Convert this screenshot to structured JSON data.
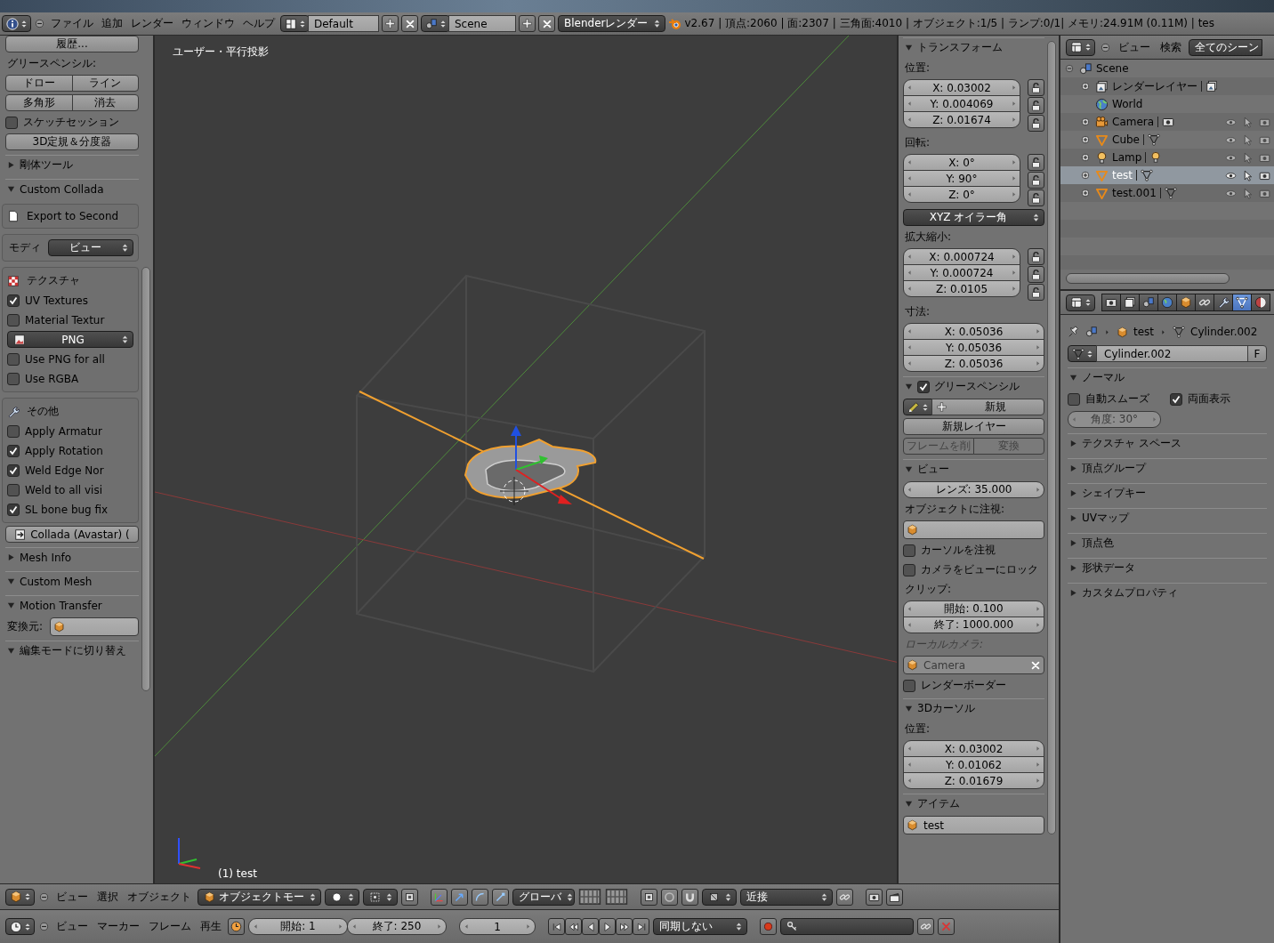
{
  "top_header": {
    "menus": [
      "ファイル",
      "追加",
      "レンダー",
      "ウィンドウ",
      "ヘルプ"
    ],
    "layout": "Default",
    "scene": "Scene",
    "engine": "Blenderレンダー",
    "stats": "v2.67 | 頂点:2060 | 面:2307 | 三角面:4010 | オブジェクト:1/5 | ランプ:0/1| メモリ:24.91M (0.11M) | tes"
  },
  "tool_shelf": {
    "rows": [
      {
        "kind": "button",
        "label": "履歴..."
      },
      {
        "kind": "label",
        "label": "グリースペンシル:"
      },
      {
        "kind": "buttons",
        "labels": [
          "ドロー",
          "ライン"
        ]
      },
      {
        "kind": "buttons",
        "labels": [
          "多角形",
          "消去"
        ]
      },
      {
        "kind": "checkbox",
        "label": "スケッチセッション",
        "checked": false
      },
      {
        "kind": "button",
        "label": "3D定規＆分度器"
      },
      {
        "kind": "header",
        "label": "剛体ツール",
        "expanded": false
      },
      {
        "kind": "header",
        "label": "Custom Collada",
        "expanded": true
      },
      {
        "kind": "box",
        "rows": [
          {
            "kind": "export_toggle",
            "label": "Export to Second"
          }
        ]
      },
      {
        "kind": "box",
        "rows": [
          {
            "kind": "dropdown",
            "label": "モディ",
            "value": "ビュー"
          }
        ]
      },
      {
        "kind": "box",
        "rows": [
          {
            "kind": "texture_heading",
            "label": "テクスチャ"
          },
          {
            "kind": "checkbox",
            "label": "UV Textures",
            "checked": true
          },
          {
            "kind": "checkbox",
            "label": "Material Textur",
            "checked": false
          },
          {
            "kind": "format_dropdown",
            "value": "PNG"
          },
          {
            "kind": "checkbox",
            "label": "Use PNG for all",
            "checked": false
          },
          {
            "kind": "checkbox",
            "label": "Use RGBA",
            "checked": false
          }
        ]
      },
      {
        "kind": "box",
        "rows": [
          {
            "kind": "settings_heading",
            "label": "その他"
          },
          {
            "kind": "checkbox",
            "label": "Apply Armatur",
            "checked": false
          },
          {
            "kind": "checkbox",
            "label": "Apply Rotation",
            "checked": true
          },
          {
            "kind": "checkbox",
            "label": "Weld Edge Nor",
            "checked": true
          },
          {
            "kind": "checkbox",
            "label": "Weld to all visi",
            "checked": false
          },
          {
            "kind": "checkbox",
            "label": "SL bone bug fix",
            "checked": true
          }
        ]
      },
      {
        "kind": "export_button",
        "label": "Collada (Avastar) ("
      },
      {
        "kind": "header",
        "label": "Mesh Info",
        "expanded": false
      },
      {
        "kind": "header",
        "label": "Custom Mesh",
        "expanded": true
      },
      {
        "kind": "header",
        "label": "Motion Transfer",
        "expanded": true
      },
      {
        "kind": "field",
        "label": "変換元:"
      },
      {
        "kind": "header",
        "label": "編集モードに切り替え",
        "expanded": true
      }
    ]
  },
  "viewport": {
    "view_label": "ユーザー・平行投影",
    "object_label": "(1) test"
  },
  "n_panel": {
    "rows": [
      {
        "kind": "header",
        "label": "トランスフォーム",
        "expanded": true
      },
      {
        "kind": "label",
        "label": "位置:"
      },
      {
        "kind": "vector",
        "values": [
          "X: 0.03002",
          "Y: 0.004069",
          "Z: 0.01674"
        ],
        "locks": true
      },
      {
        "kind": "label",
        "label": "回転:"
      },
      {
        "kind": "vector",
        "values": [
          "X: 0°",
          "Y: 90°",
          "Z: 0°"
        ],
        "locks": true
      },
      {
        "kind": "dropdown",
        "value": "XYZ オイラー角"
      },
      {
        "kind": "label",
        "label": "拡大縮小:"
      },
      {
        "kind": "vector",
        "values": [
          "X: 0.000724",
          "Y: 0.000724",
          "Z: 0.0105"
        ],
        "locks": true
      },
      {
        "kind": "label",
        "label": "寸法:"
      },
      {
        "kind": "vector",
        "values": [
          "X: 0.05036",
          "Y: 0.05036",
          "Z: 0.05036"
        ],
        "locks": false
      },
      {
        "kind": "header",
        "label": "グリースペンシル",
        "expanded": true,
        "checked": true
      },
      {
        "kind": "new_button",
        "label": "新規"
      },
      {
        "kind": "button",
        "label": "新規レイヤー"
      },
      {
        "kind": "buttons",
        "labels": [
          "フレームを削",
          "変換"
        ],
        "disabled": true
      },
      {
        "kind": "header",
        "label": "ビュー",
        "expanded": true
      },
      {
        "kind": "number",
        "value": "レンズ: 35.000"
      },
      {
        "kind": "label",
        "label": "オブジェクトに注視:"
      },
      {
        "kind": "object_field"
      },
      {
        "kind": "checkbox",
        "label": "カーソルを注視",
        "checked": false
      },
      {
        "kind": "checkbox",
        "label": "カメラをビューにロック",
        "checked": false
      },
      {
        "kind": "label",
        "label": "クリップ:"
      },
      {
        "kind": "vector",
        "values": [
          "開始: 0.100",
          "終了: 1000.000"
        ],
        "locks": false
      },
      {
        "kind": "label",
        "label": "ローカルカメラ:",
        "disabled": true
      },
      {
        "kind": "object_field",
        "value": "Camera",
        "disabled": true,
        "clearable": true
      },
      {
        "kind": "checkbox",
        "label": "レンダーボーダー",
        "checked": false
      },
      {
        "kind": "header",
        "label": "3Dカーソル",
        "expanded": true
      },
      {
        "kind": "label",
        "label": "位置:"
      },
      {
        "kind": "vector",
        "values": [
          "X: 0.03002",
          "Y: 0.01062",
          "Z: 0.01679"
        ],
        "locks": false
      },
      {
        "kind": "header",
        "label": "アイテム",
        "expanded": true
      },
      {
        "kind": "object_field",
        "value": "test"
      }
    ]
  },
  "outliner": {
    "menus": [
      "ビュー",
      "検索"
    ],
    "scope": "全てのシーン",
    "tree": [
      {
        "label": "Scene",
        "kind": "scene",
        "expanded": true,
        "selected": false,
        "children": [
          {
            "label": "レンダーレイヤー",
            "kind": "renderlayer",
            "expanded": false,
            "selected": false
          },
          {
            "label": "World",
            "kind": "world",
            "selected": false
          },
          {
            "label": "Camera",
            "kind": "camera",
            "expanded": false,
            "selected": false
          },
          {
            "label": "Cube",
            "kind": "mesh",
            "expanded": false,
            "selected": false
          },
          {
            "label": "Lamp",
            "kind": "lamp",
            "expanded": false,
            "selected": false
          },
          {
            "label": "test",
            "kind": "mesh",
            "expanded": false,
            "selected": true
          },
          {
            "label": "test.001",
            "kind": "mesh",
            "expanded": false,
            "selected": false
          }
        ]
      }
    ]
  },
  "properties": {
    "tabs": [
      {
        "kind": "render",
        "selected": false
      },
      {
        "kind": "renderlayers",
        "selected": false
      },
      {
        "kind": "scene",
        "selected": false
      },
      {
        "kind": "world",
        "selected": false
      },
      {
        "kind": "object",
        "selected": false
      },
      {
        "kind": "constraints",
        "selected": false
      },
      {
        "kind": "modifiers",
        "selected": false
      },
      {
        "kind": "data",
        "selected": true
      },
      {
        "kind": "material",
        "selected": false
      }
    ],
    "breadcrumb": {
      "object": "test",
      "mesh": "Cylinder.002"
    },
    "datablock": {
      "name": "Cylinder.002",
      "fake_user": "F"
    },
    "rows": [
      {
        "kind": "header",
        "label": "ノーマル",
        "expanded": true
      },
      {
        "kind": "checkbox_pair",
        "items": [
          {
            "label": "自動スムーズ",
            "checked": false
          },
          {
            "label": "両面表示",
            "checked": true
          }
        ]
      },
      {
        "kind": "number",
        "value": "角度: 30°",
        "disabled": true
      },
      {
        "kind": "header",
        "label": "テクスチャ スペース",
        "expanded": false
      },
      {
        "kind": "header",
        "label": "頂点グループ",
        "expanded": false
      },
      {
        "kind": "header",
        "label": "シェイプキー",
        "expanded": false
      },
      {
        "kind": "header",
        "label": "UVマップ",
        "expanded": false
      },
      {
        "kind": "header",
        "label": "頂点色",
        "expanded": false
      },
      {
        "kind": "header",
        "label": "形状データ",
        "expanded": false
      },
      {
        "kind": "header",
        "label": "カスタムプロパティ",
        "expanded": false
      }
    ]
  },
  "view3d_header": {
    "menus": [
      "ビュー",
      "選択",
      "オブジェクト"
    ],
    "mode": "オブジェクトモー",
    "orientation": "グローバ",
    "snap": "近接"
  },
  "timeline": {
    "menus": [
      "ビュー",
      "マーカー",
      "フレーム",
      "再生"
    ],
    "start": "開始: 1",
    "end": "終了: 250",
    "current": "1",
    "sync": "同期しない"
  }
}
